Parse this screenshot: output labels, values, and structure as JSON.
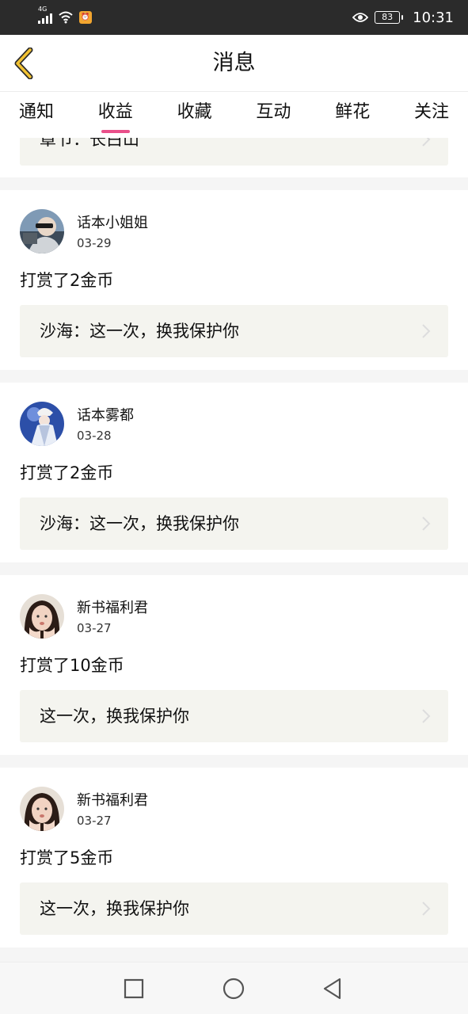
{
  "status_bar": {
    "network": "4G",
    "battery": "83",
    "time": "10:31",
    "icons": [
      "signal-icon",
      "wifi-icon",
      "alarm-icon",
      "eye-icon",
      "battery-icon"
    ]
  },
  "header": {
    "title": "消息",
    "back_icon": "chevron-left-icon"
  },
  "tabs": [
    {
      "label": "通知",
      "active": false
    },
    {
      "label": "收益",
      "active": true
    },
    {
      "label": "收藏",
      "active": false
    },
    {
      "label": "互动",
      "active": false
    },
    {
      "label": "鲜花",
      "active": false
    },
    {
      "label": "关注",
      "active": false
    }
  ],
  "partial_card": {
    "book_ref": "章节：长白山"
  },
  "messages": [
    {
      "user": "话本小姐姐",
      "date": "03-29",
      "text": "打赏了2金币",
      "book_ref": "沙海：这一次，换我保护你"
    },
    {
      "user": "话本雾都",
      "date": "03-28",
      "text": "打赏了2金币",
      "book_ref": "沙海：这一次，换我保护你"
    },
    {
      "user": "新书福利君",
      "date": "03-27",
      "text": "打赏了10金币",
      "book_ref": "这一次，换我保护你"
    },
    {
      "user": "新书福利君",
      "date": "03-27",
      "text": "打赏了5金币",
      "book_ref": "这一次，换我保护你"
    }
  ],
  "nav_bar": {
    "icons": [
      "recent-apps-icon",
      "home-icon",
      "back-icon"
    ]
  },
  "colors": {
    "accent": "#e9508a",
    "back_arrow": "#f2c233",
    "status_bar": "#2b2b2b",
    "ref_background": "#f4f4ef"
  }
}
